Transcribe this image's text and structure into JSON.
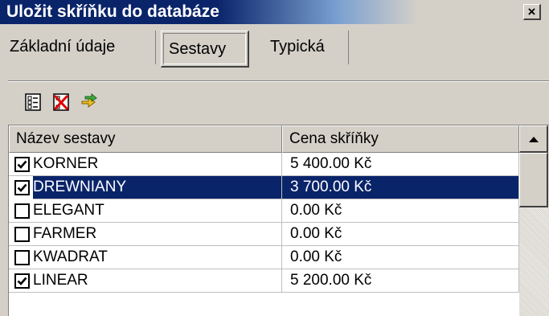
{
  "window": {
    "title": "Uložit skříňku do databáze",
    "close_glyph": "×"
  },
  "tabs": [
    {
      "label": "Základní údaje",
      "active": false
    },
    {
      "label": "Sestavy",
      "active": true
    },
    {
      "label": "Typická",
      "active": false
    }
  ],
  "toolbar": {
    "icons": [
      "select-all-icon",
      "delete-icon",
      "transfer-icon"
    ]
  },
  "grid": {
    "columns": [
      "Název sestavy",
      "Cena skříňky"
    ],
    "rows": [
      {
        "checked": true,
        "name": "KORNER",
        "price": "5 400.00 Kč",
        "selected": false
      },
      {
        "checked": true,
        "name": "DREWNIANY",
        "price": "3 700.00 Kč",
        "selected": true
      },
      {
        "checked": false,
        "name": "ELEGANT",
        "price": "0.00 Kč",
        "selected": false
      },
      {
        "checked": false,
        "name": "FARMER",
        "price": "0.00 Kč",
        "selected": false
      },
      {
        "checked": false,
        "name": "KWADRAT",
        "price": "0.00 Kč",
        "selected": false
      },
      {
        "checked": true,
        "name": "LINEAR",
        "price": "5 200.00 Kč",
        "selected": false
      }
    ]
  },
  "colors": {
    "title_bar": "#0a246a",
    "selection": "#0a246a",
    "face": "#d4d0c8"
  }
}
